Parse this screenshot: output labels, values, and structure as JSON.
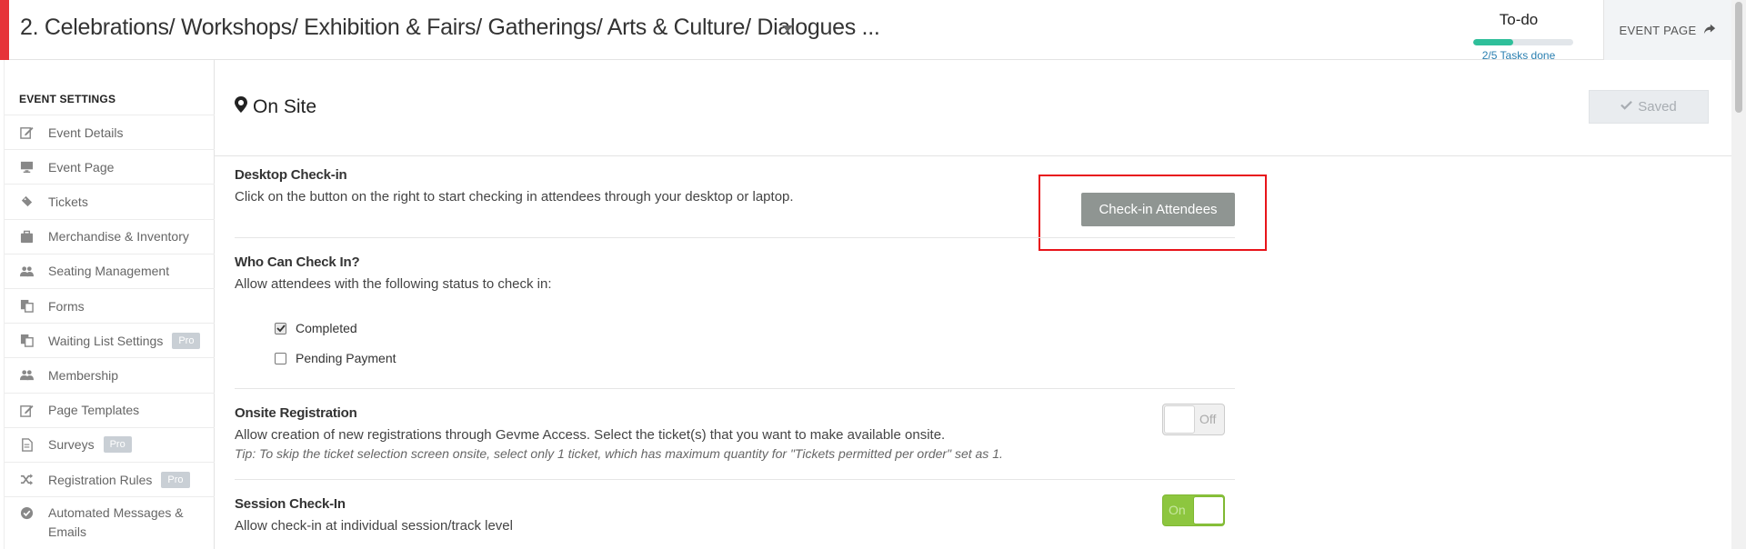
{
  "header": {
    "event_title": "2. Celebrations/ Workshops/ Exhibition & Fairs/ Gatherings/ Arts & Culture/ Dialogues ...",
    "todo_label": "To-do",
    "tasks_done": "2/5 Tasks done",
    "tasks_progress": 0.4,
    "event_page_button": "EVENT PAGE",
    "accent_color": "#e63338"
  },
  "sidebar": {
    "section_title": "EVENT SETTINGS",
    "items": [
      {
        "label": "Event Details",
        "icon": "edit-icon"
      },
      {
        "label": "Event Page",
        "icon": "monitor-icon"
      },
      {
        "label": "Tickets",
        "icon": "tickets-icon"
      },
      {
        "label": "Merchandise & Inventory",
        "icon": "briefcase-icon"
      },
      {
        "label": "Seating Management",
        "icon": "users-icon"
      },
      {
        "label": "Forms",
        "icon": "copy-icon"
      },
      {
        "label": "Waiting List Settings",
        "icon": "copy-icon",
        "badge": "Pro"
      },
      {
        "label": "Membership",
        "icon": "users-icon"
      },
      {
        "label": "Page Templates",
        "icon": "edit-icon"
      },
      {
        "label": "Surveys",
        "icon": "document-icon",
        "badge": "Pro"
      },
      {
        "label": "Registration Rules",
        "icon": "shuffle-icon",
        "badge": "Pro"
      },
      {
        "label": "Automated Messages & Emails",
        "icon": "check-circle-icon"
      }
    ]
  },
  "main": {
    "title": "On Site",
    "saved_button": "Saved",
    "desktop_checkin": {
      "heading": "Desktop Check-in",
      "description": "Click on the button on the right to start checking in attendees through your desktop or laptop.",
      "button": "Check-in Attendees"
    },
    "who_can_check_in": {
      "heading": "Who Can Check In?",
      "description": "Allow attendees with the following status to check in:",
      "options": [
        {
          "label": "Completed",
          "checked": true
        },
        {
          "label": "Pending Payment",
          "checked": false
        }
      ]
    },
    "onsite_registration": {
      "heading": "Onsite Registration",
      "description": "Allow creation of new registrations through Gevme Access. Select the ticket(s) that you want to make available onsite.",
      "tip": "Tip: To skip the ticket selection screen onsite, select only 1 ticket, which has maximum quantity for \"Tickets permitted per order\" set as 1.",
      "toggle": "Off"
    },
    "session_checkin": {
      "heading": "Session Check-In",
      "description": "Allow check-in at individual session/track level",
      "toggle": "On"
    }
  }
}
